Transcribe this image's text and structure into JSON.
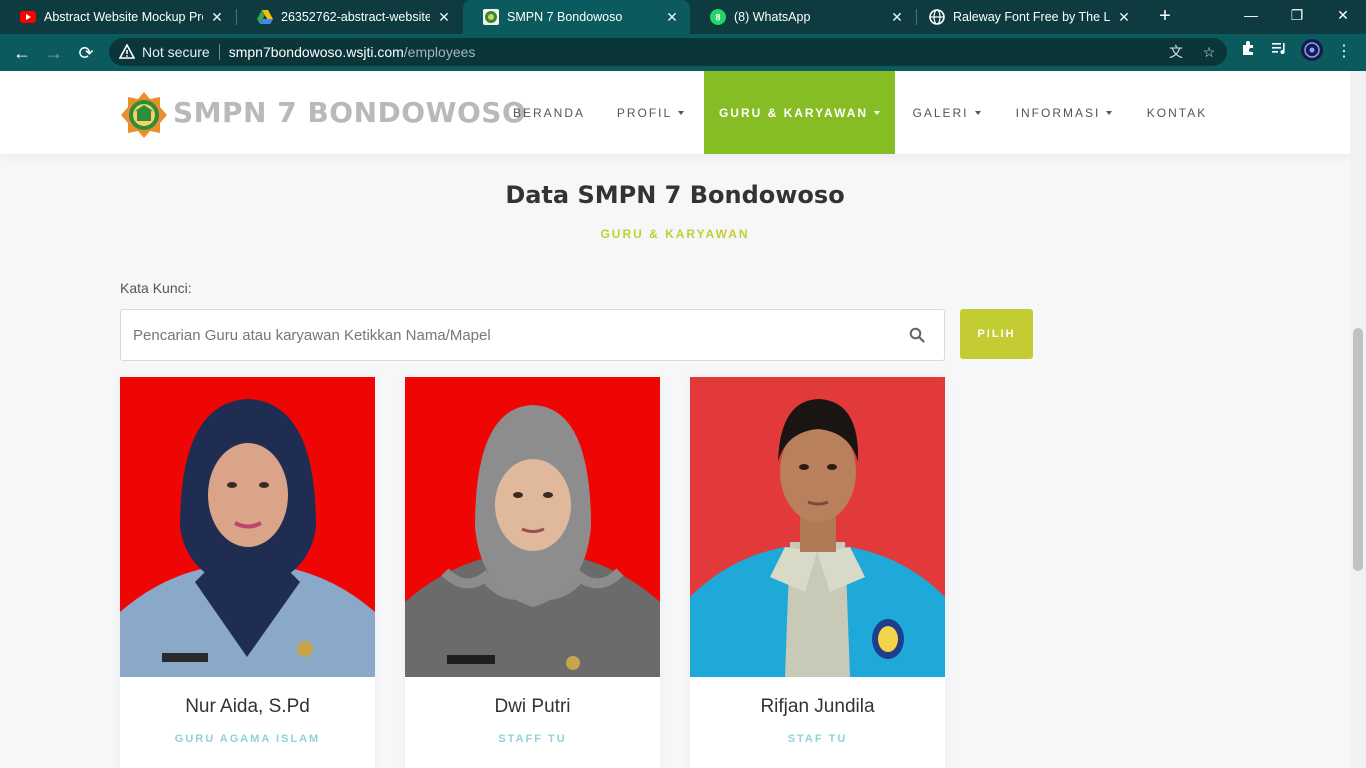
{
  "browser": {
    "tabs": [
      {
        "title": "Abstract Website Mockup Prom",
        "icon": "youtube-icon"
      },
      {
        "title": "26352762-abstract-website-mo",
        "icon": "google-drive-icon"
      },
      {
        "title": "SMPN 7 Bondowoso",
        "icon": "school-favicon",
        "active": true
      },
      {
        "title": "(8) WhatsApp",
        "icon": "whatsapp-icon"
      },
      {
        "title": "Raleway Font Free by The Leag",
        "icon": "globe-icon"
      }
    ],
    "security_label": "Not secure",
    "url_host": "smpn7bondowoso.wsjti.com",
    "url_path": "/employees",
    "accent_color": "#0b5a5e"
  },
  "site": {
    "brand": "SMPN 7 BONDOWOSO",
    "nav": [
      {
        "label": "BERANDA",
        "dropdown": false
      },
      {
        "label": "PROFIL",
        "dropdown": true
      },
      {
        "label": "GURU & KARYAWAN",
        "dropdown": true,
        "active": true
      },
      {
        "label": "GALERI",
        "dropdown": true
      },
      {
        "label": "INFORMASI",
        "dropdown": true
      },
      {
        "label": "KONTAK",
        "dropdown": false
      }
    ],
    "active_color": "#86bc24"
  },
  "section": {
    "title": "Data SMPN 7 Bondowoso",
    "subtitle": "GURU & KARYAWAN"
  },
  "search": {
    "label": "Kata Kunci:",
    "placeholder": "Pencarian Guru atau karyawan Ketikkan Nama/Mapel",
    "value": "",
    "button_label": "PILIH"
  },
  "employees": [
    {
      "name": "Nur Aida, S.Pd",
      "role": "GURU AGAMA ISLAM"
    },
    {
      "name": "Dwi Putri",
      "role": "STAFF TU"
    },
    {
      "name": "Rifjan Jundila",
      "role": "STAF TU"
    }
  ]
}
